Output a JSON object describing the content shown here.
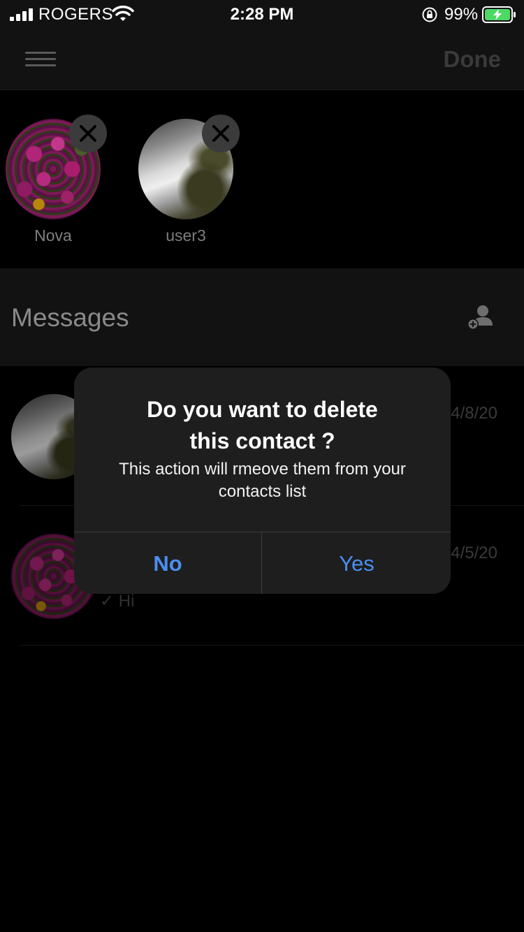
{
  "status_bar": {
    "carrier": "ROGERS",
    "time": "2:28 PM",
    "battery_percent": "99%"
  },
  "nav": {
    "done_label": "Done"
  },
  "favorites": [
    {
      "name": "Nova",
      "image": "flowers"
    },
    {
      "name": "user3",
      "image": "waterfall"
    }
  ],
  "messages_header": {
    "title": "Messages",
    "add_icon": "add-person-icon"
  },
  "messages": [
    {
      "date": "4/8/20",
      "preview": "",
      "image": "waterfall"
    },
    {
      "date": "4/5/20",
      "preview": "✓ Hi",
      "image": "flowers"
    }
  ],
  "alert": {
    "title": "Do you want to delete this contact ?",
    "message": "This action will rmeove them from your contacts list",
    "no_label": "No",
    "yes_label": "Yes",
    "button_color": "#4b8ef0"
  }
}
